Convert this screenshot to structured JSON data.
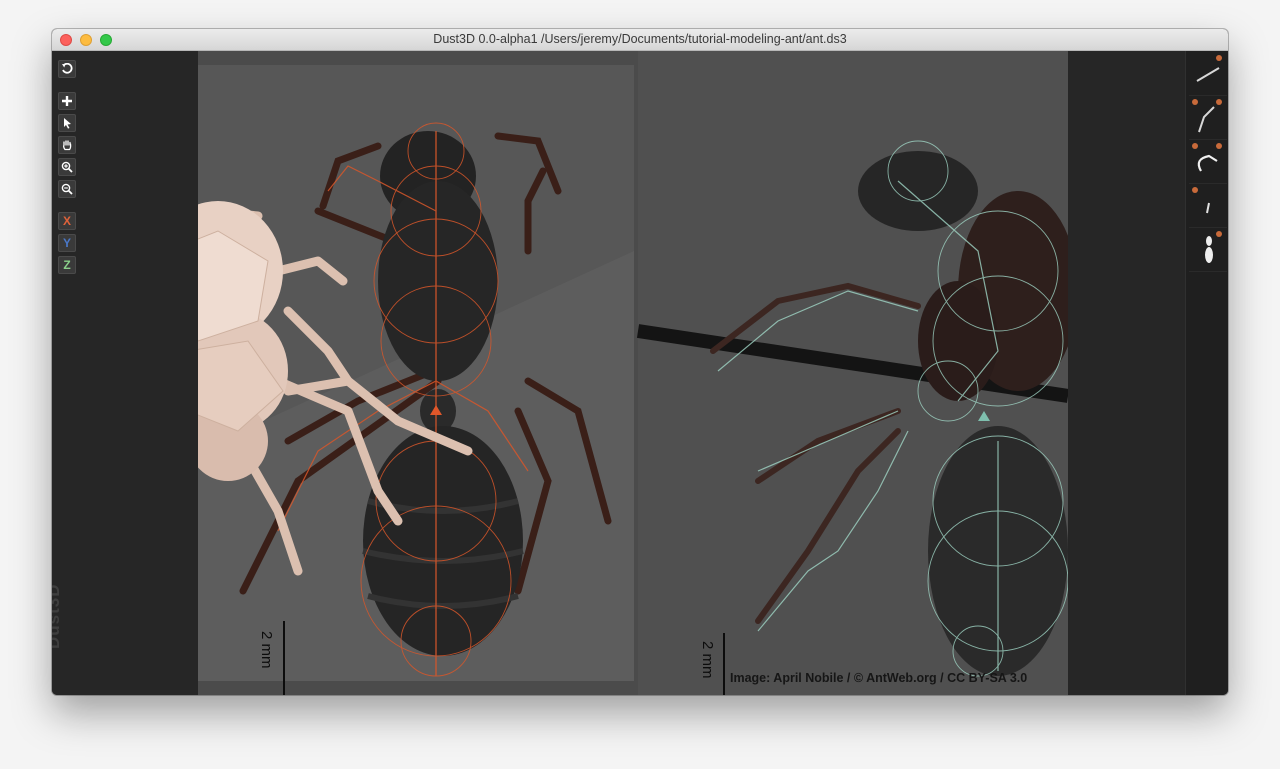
{
  "window": {
    "title": "Dust3D 0.0-alpha1 /Users/jeremy/Documents/tutorial-modeling-ant/ant.ds3"
  },
  "toolbar": {
    "undo": {
      "icon": "undo-icon"
    },
    "add": {
      "icon": "add-icon"
    },
    "select": {
      "icon": "select-icon"
    },
    "drag": {
      "icon": "hand-icon"
    },
    "zoom_in": {
      "icon": "zoom-in-icon"
    },
    "zoom_out": {
      "icon": "zoom-out-icon"
    },
    "axes": [
      {
        "label": "X",
        "color": "#e0623a"
      },
      {
        "label": "Y",
        "color": "#4a78c8"
      },
      {
        "label": "Z",
        "color": "#8ad08a"
      }
    ],
    "brand": "Dust3D"
  },
  "canvas": {
    "front_scale": "2 mm",
    "side_scale": "2 mm",
    "credit": "Image: April Nobile / © AntWeb.org / CC BY-SA 3.0",
    "front_node_color": "#e0572a",
    "side_node_color": "#9fd4c4",
    "model_color": "#e8d1c4"
  },
  "parts": {
    "count_label": ""
  }
}
